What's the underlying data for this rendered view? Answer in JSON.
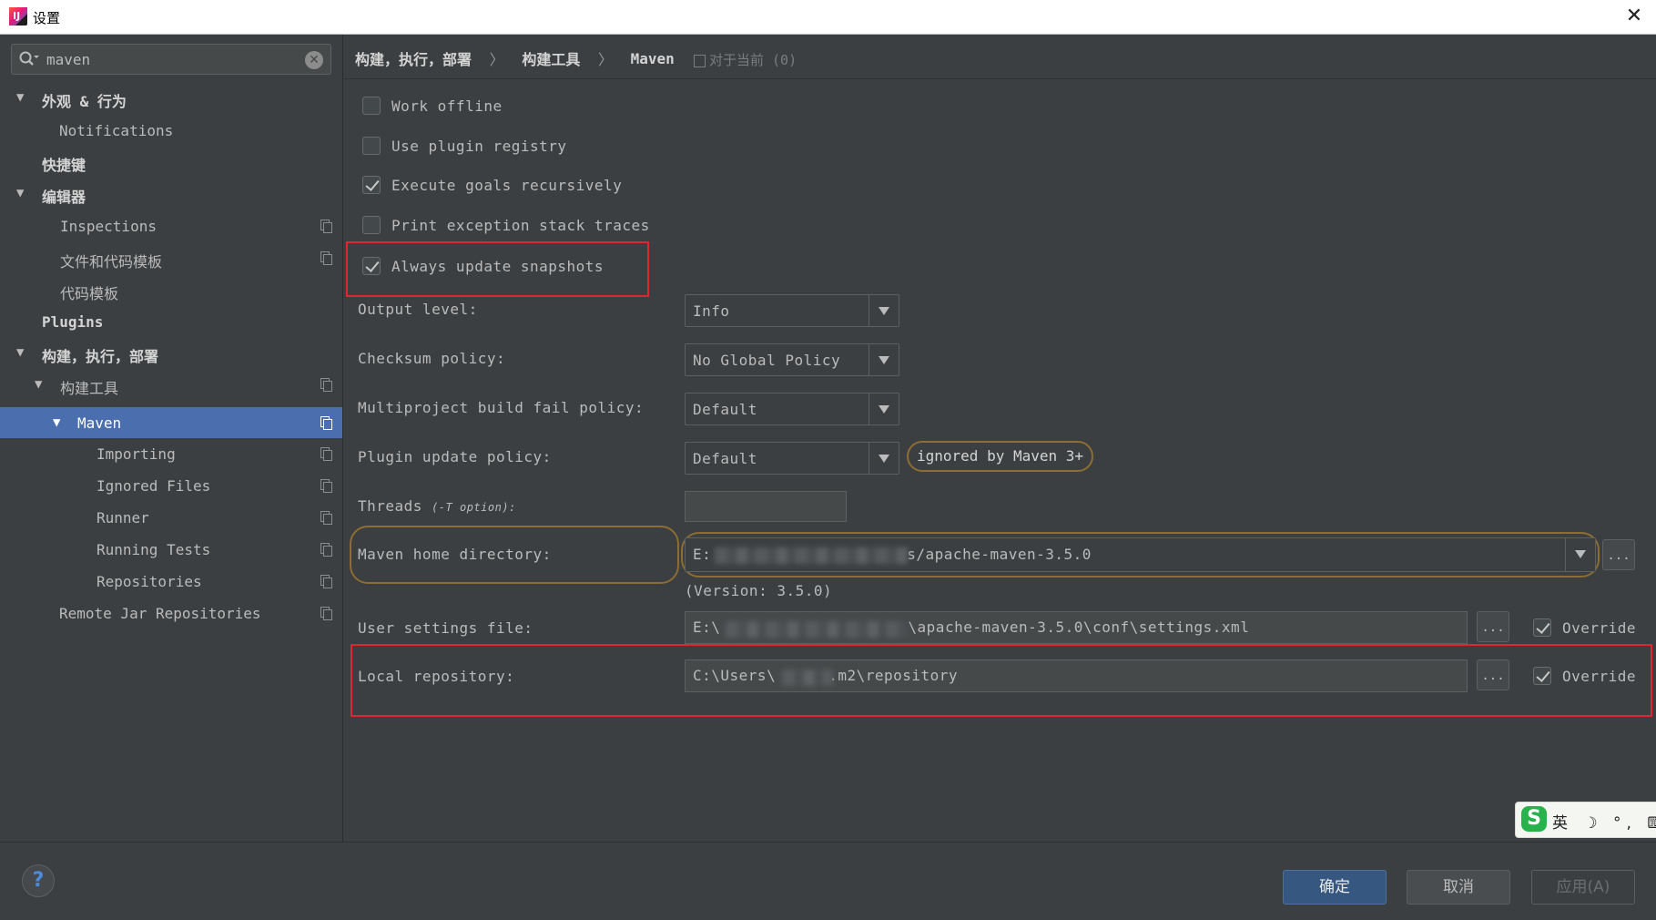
{
  "window": {
    "title": "设置",
    "app_icon": "intellij-icon",
    "close_label": "✕"
  },
  "search": {
    "value": "maven"
  },
  "sidebar": {
    "items": [
      {
        "label": "外观 & 行为",
        "expanded": true
      },
      {
        "label": "Notifications"
      },
      {
        "label": "快捷键"
      },
      {
        "label": "编辑器",
        "expanded": true
      },
      {
        "label": "Inspections"
      },
      {
        "label": "文件和代码模板"
      },
      {
        "label": "代码模板"
      },
      {
        "label": "Plugins"
      },
      {
        "label": "构建，执行，部署",
        "expanded": true
      },
      {
        "label": "构建工具",
        "expanded": true
      },
      {
        "label": "Maven",
        "expanded": true,
        "selected": true
      },
      {
        "label": "Importing"
      },
      {
        "label": "Ignored Files"
      },
      {
        "label": "Runner"
      },
      {
        "label": "Running Tests"
      },
      {
        "label": "Repositories"
      },
      {
        "label": "Remote Jar Repositories"
      }
    ]
  },
  "breadcrumb": {
    "items": [
      "构建，执行，部署",
      "构建工具",
      "Maven"
    ],
    "separator": "〉",
    "for_current": "对于当前 (0)"
  },
  "options": {
    "work_offline": {
      "label": "Work offline",
      "checked": false
    },
    "use_plugin_registry": {
      "label": "Use plugin registry",
      "checked": false
    },
    "execute_goals_recursively": {
      "label": "Execute goals recursively",
      "checked": true
    },
    "print_exception_stack_traces": {
      "label": "Print exception stack traces",
      "checked": false
    },
    "always_update_snapshots": {
      "label": "Always update snapshots",
      "checked": true
    }
  },
  "fields": {
    "output_level": {
      "label": "Output level:",
      "value": "Info"
    },
    "checksum_policy": {
      "label": "Checksum policy:",
      "value": "No Global Policy"
    },
    "multiproject_fail_policy": {
      "label": "Multiproject build fail policy:",
      "value": "Default"
    },
    "plugin_update_policy": {
      "label": "Plugin update policy:",
      "value": "Default",
      "hint": "ignored by Maven 3+"
    },
    "threads": {
      "label": "Threads",
      "sublabel": "(-T option):",
      "value": ""
    },
    "maven_home": {
      "label": "Maven home directory:",
      "value_prefix": "E:",
      "value_suffix": "s/apache-maven-3.5.0",
      "version": "(Version: 3.5.0)"
    },
    "user_settings": {
      "label": "User settings file:",
      "value_prefix": "E:\\",
      "value_suffix": "\\apache-maven-3.5.0\\conf\\settings.xml",
      "override_label": "Override",
      "override": true
    },
    "local_repository": {
      "label": "Local repository:",
      "value_prefix": "C:\\Users\\",
      "value_suffix": ".m2\\repository",
      "override_label": "Override",
      "override": true
    }
  },
  "browse_label": "...",
  "ime": {
    "logo": "S",
    "text": "英 ☽ °, ⌨"
  },
  "buttons": {
    "ok": "确定",
    "cancel": "取消",
    "apply": "应用(A)",
    "help": "?"
  },
  "colors": {
    "selection": "#4b6eaf",
    "red_highlight": "#e0272e",
    "amber_highlight": "#8c6d32",
    "primary_button": "#365880"
  }
}
